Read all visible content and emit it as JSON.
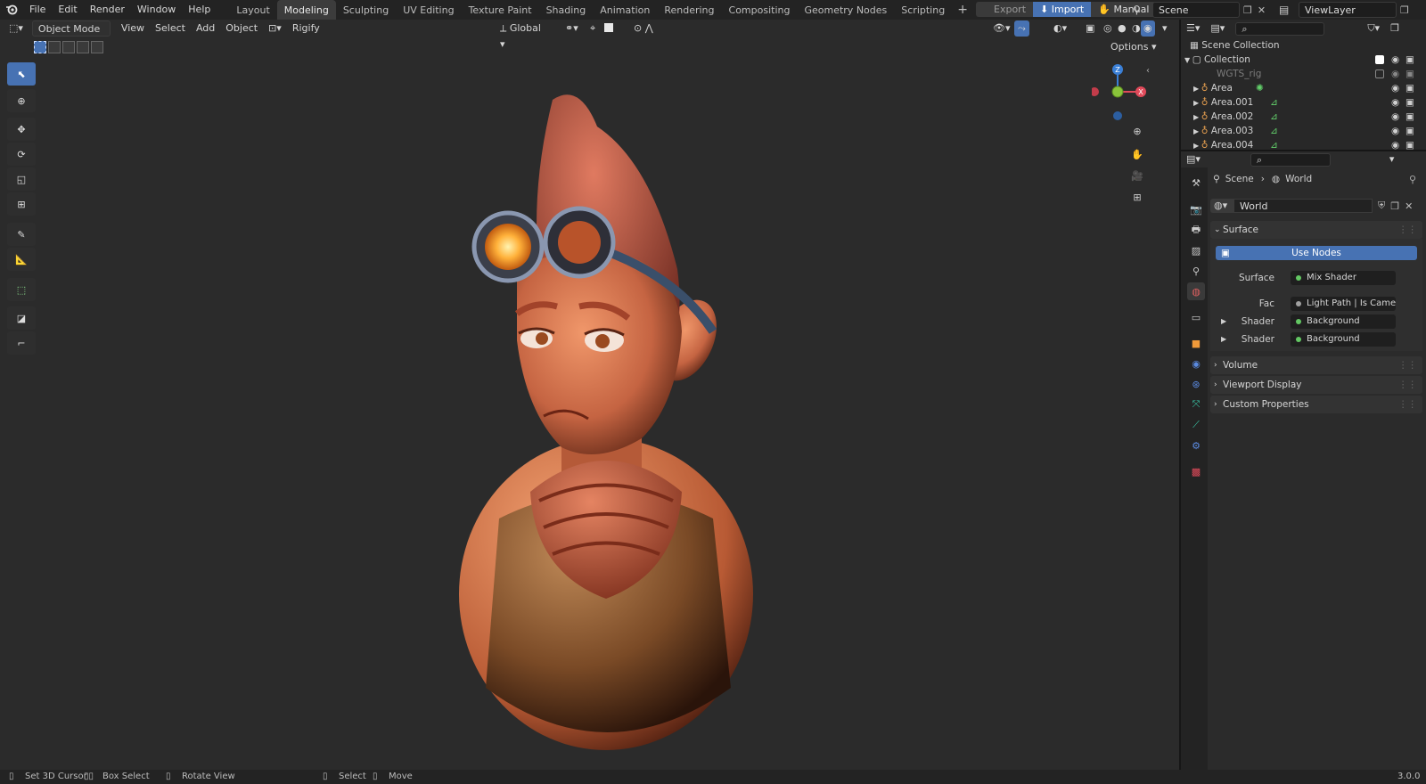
{
  "topbar": {
    "menus": [
      "File",
      "Edit",
      "Render",
      "Window",
      "Help"
    ],
    "workspaces": [
      "Layout",
      "Modeling",
      "Sculpting",
      "UV Editing",
      "Texture Paint",
      "Shading",
      "Animation",
      "Rendering",
      "Compositing",
      "Geometry Nodes",
      "Scripting"
    ],
    "active_workspace": "Modeling",
    "export_label": "Export",
    "import_label": "Import",
    "manual_label": "Manual",
    "scene_name": "Scene",
    "view_layer": "ViewLayer"
  },
  "viewport": {
    "mode": "Object Mode",
    "menus": [
      "View",
      "Select",
      "Add",
      "Object"
    ],
    "rigify": "Rigify",
    "orientation": "Global",
    "options_label": "Options",
    "gizmo_axes": {
      "z": "Z",
      "x": "X"
    }
  },
  "outliner": {
    "root": "Scene Collection",
    "collection": "Collection",
    "items": [
      {
        "name": "WGTS_rig",
        "muted": true
      },
      {
        "name": "Area",
        "muted": false
      },
      {
        "name": "Area.001",
        "muted": false
      },
      {
        "name": "Area.002",
        "muted": false
      },
      {
        "name": "Area.003",
        "muted": false
      },
      {
        "name": "Area.004",
        "muted": false
      }
    ]
  },
  "properties": {
    "breadcrumb_scene": "Scene",
    "breadcrumb_world": "World",
    "world_name": "World",
    "surface_panel": "Surface",
    "use_nodes": "Use Nodes",
    "rows": [
      {
        "label": "Surface",
        "value": "Mix Shader",
        "dot": "green"
      },
      {
        "label": "Fac",
        "value": "Light Path | Is Camera ...",
        "dot": "grey"
      },
      {
        "label": "Shader",
        "value": "Background",
        "dot": "green"
      },
      {
        "label": "Shader",
        "value": "Background",
        "dot": "green"
      }
    ],
    "panels": [
      "Volume",
      "Viewport Display",
      "Custom Properties"
    ]
  },
  "statusbar": {
    "set_cursor": "Set 3D Cursor",
    "box_select": "Box Select",
    "rotate_view": "Rotate View",
    "select": "Select",
    "move": "Move",
    "version": "3.0.0"
  },
  "colors": {
    "accent": "#4772b3",
    "x_axis": "#e04a5a",
    "y_axis": "#8ac43a",
    "z_axis": "#3a7fd6"
  }
}
